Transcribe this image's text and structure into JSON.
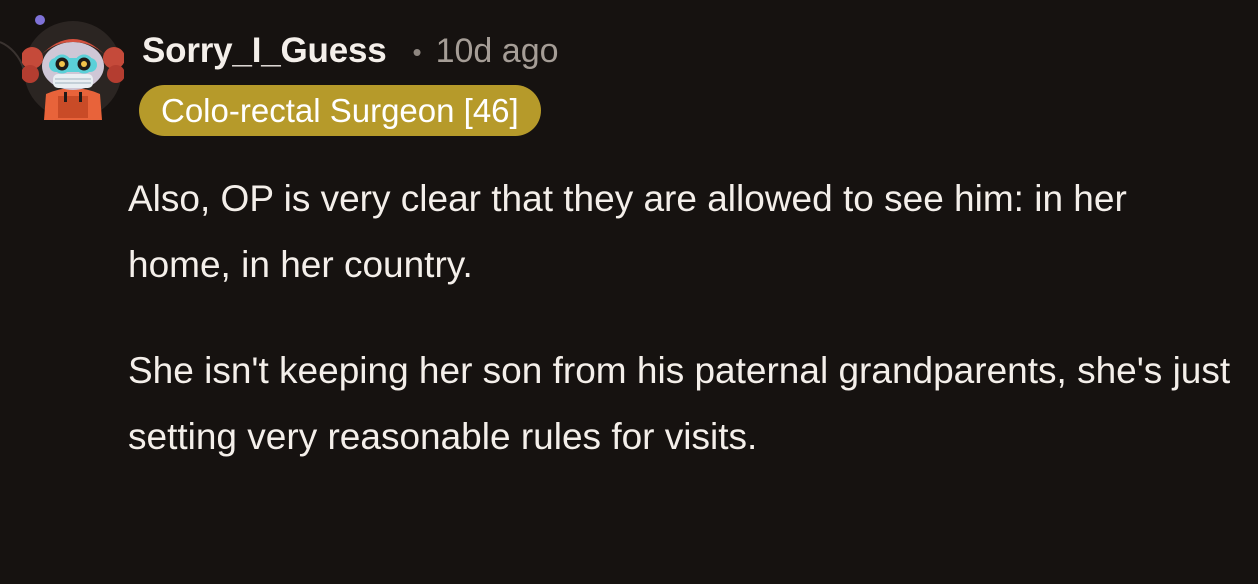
{
  "comment": {
    "username": "Sorry_I_Guess",
    "separator": "•",
    "timestamp": "10d ago",
    "flair": "Colo-rectal Surgeon [46]",
    "avatar_icon": "snoo-avatar-icon",
    "paragraphs": [
      "Also, OP is very clear that they are allowed to see him: in her home, in her country.",
      "She isn't keeping her son from his paternal grandparents, she's just setting very reasonable rules for visits."
    ]
  },
  "colors": {
    "background": "#161210",
    "flair_background": "#b69a2a",
    "text": "#f4efea",
    "meta_text": "#a59d96"
  }
}
